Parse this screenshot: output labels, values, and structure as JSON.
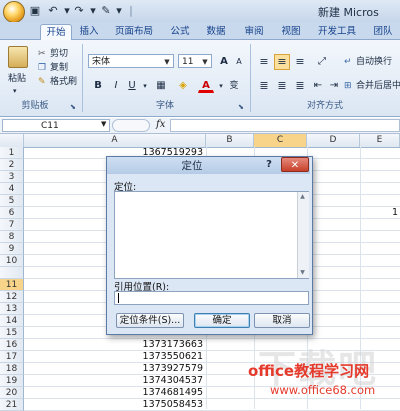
{
  "window": {
    "title": "新建 Micros"
  },
  "ribbon": {
    "tabs": [
      "开始",
      "插入",
      "页面布局",
      "公式",
      "数据",
      "审阅",
      "视图",
      "开发工具",
      "团队"
    ],
    "active_tab": "开始",
    "clipboard": {
      "paste": "粘贴",
      "cut": "剪切",
      "copy": "复制",
      "format_painter": "格式刷",
      "group_label": "剪贴板"
    },
    "font": {
      "font_name": "宋体",
      "font_size": "11",
      "grow": "A",
      "shrink": "A",
      "bold": "B",
      "italic": "I",
      "underline": "U",
      "font_color": "A",
      "phonetic": "变",
      "group_label": "字体"
    },
    "alignment": {
      "wrap_text": "自动换行",
      "merge_center": "合并后居中",
      "group_label": "对齐方式"
    }
  },
  "formula_bar": {
    "name_box": "C11",
    "fx": "fx"
  },
  "grid": {
    "columns": [
      "A",
      "B",
      "C",
      "D",
      "E"
    ],
    "selected_column": "C",
    "rows": [
      "1",
      "2",
      "3",
      "4",
      "5",
      "6",
      "7",
      "8",
      "9",
      "10",
      "11",
      "12",
      "13",
      "14",
      "15",
      "16",
      "17",
      "18",
      "19",
      "20",
      "21"
    ],
    "selected_row": "11",
    "cells": {
      "a1": "1367519293",
      "a16": "1373173663",
      "a17": "1373550621",
      "a18": "1373927579",
      "a19": "1374304537",
      "a20": "1374681495",
      "a21": "1375058453",
      "e6": "1"
    }
  },
  "dialog": {
    "title": "定位",
    "help": "?",
    "close": "✕",
    "goto_label": "定位:",
    "reference_label": "引用位置(R):",
    "reference_value": "",
    "special_button": "定位条件(S)...",
    "ok_button": "确定",
    "cancel_button": "取消"
  },
  "watermark": {
    "site_name": "office教程学习网",
    "url": "www.office68.com"
  },
  "colors": {
    "dialog_close": "#c7412b",
    "selection_header": "#f7d48a",
    "watermark": "#e53a2b"
  }
}
